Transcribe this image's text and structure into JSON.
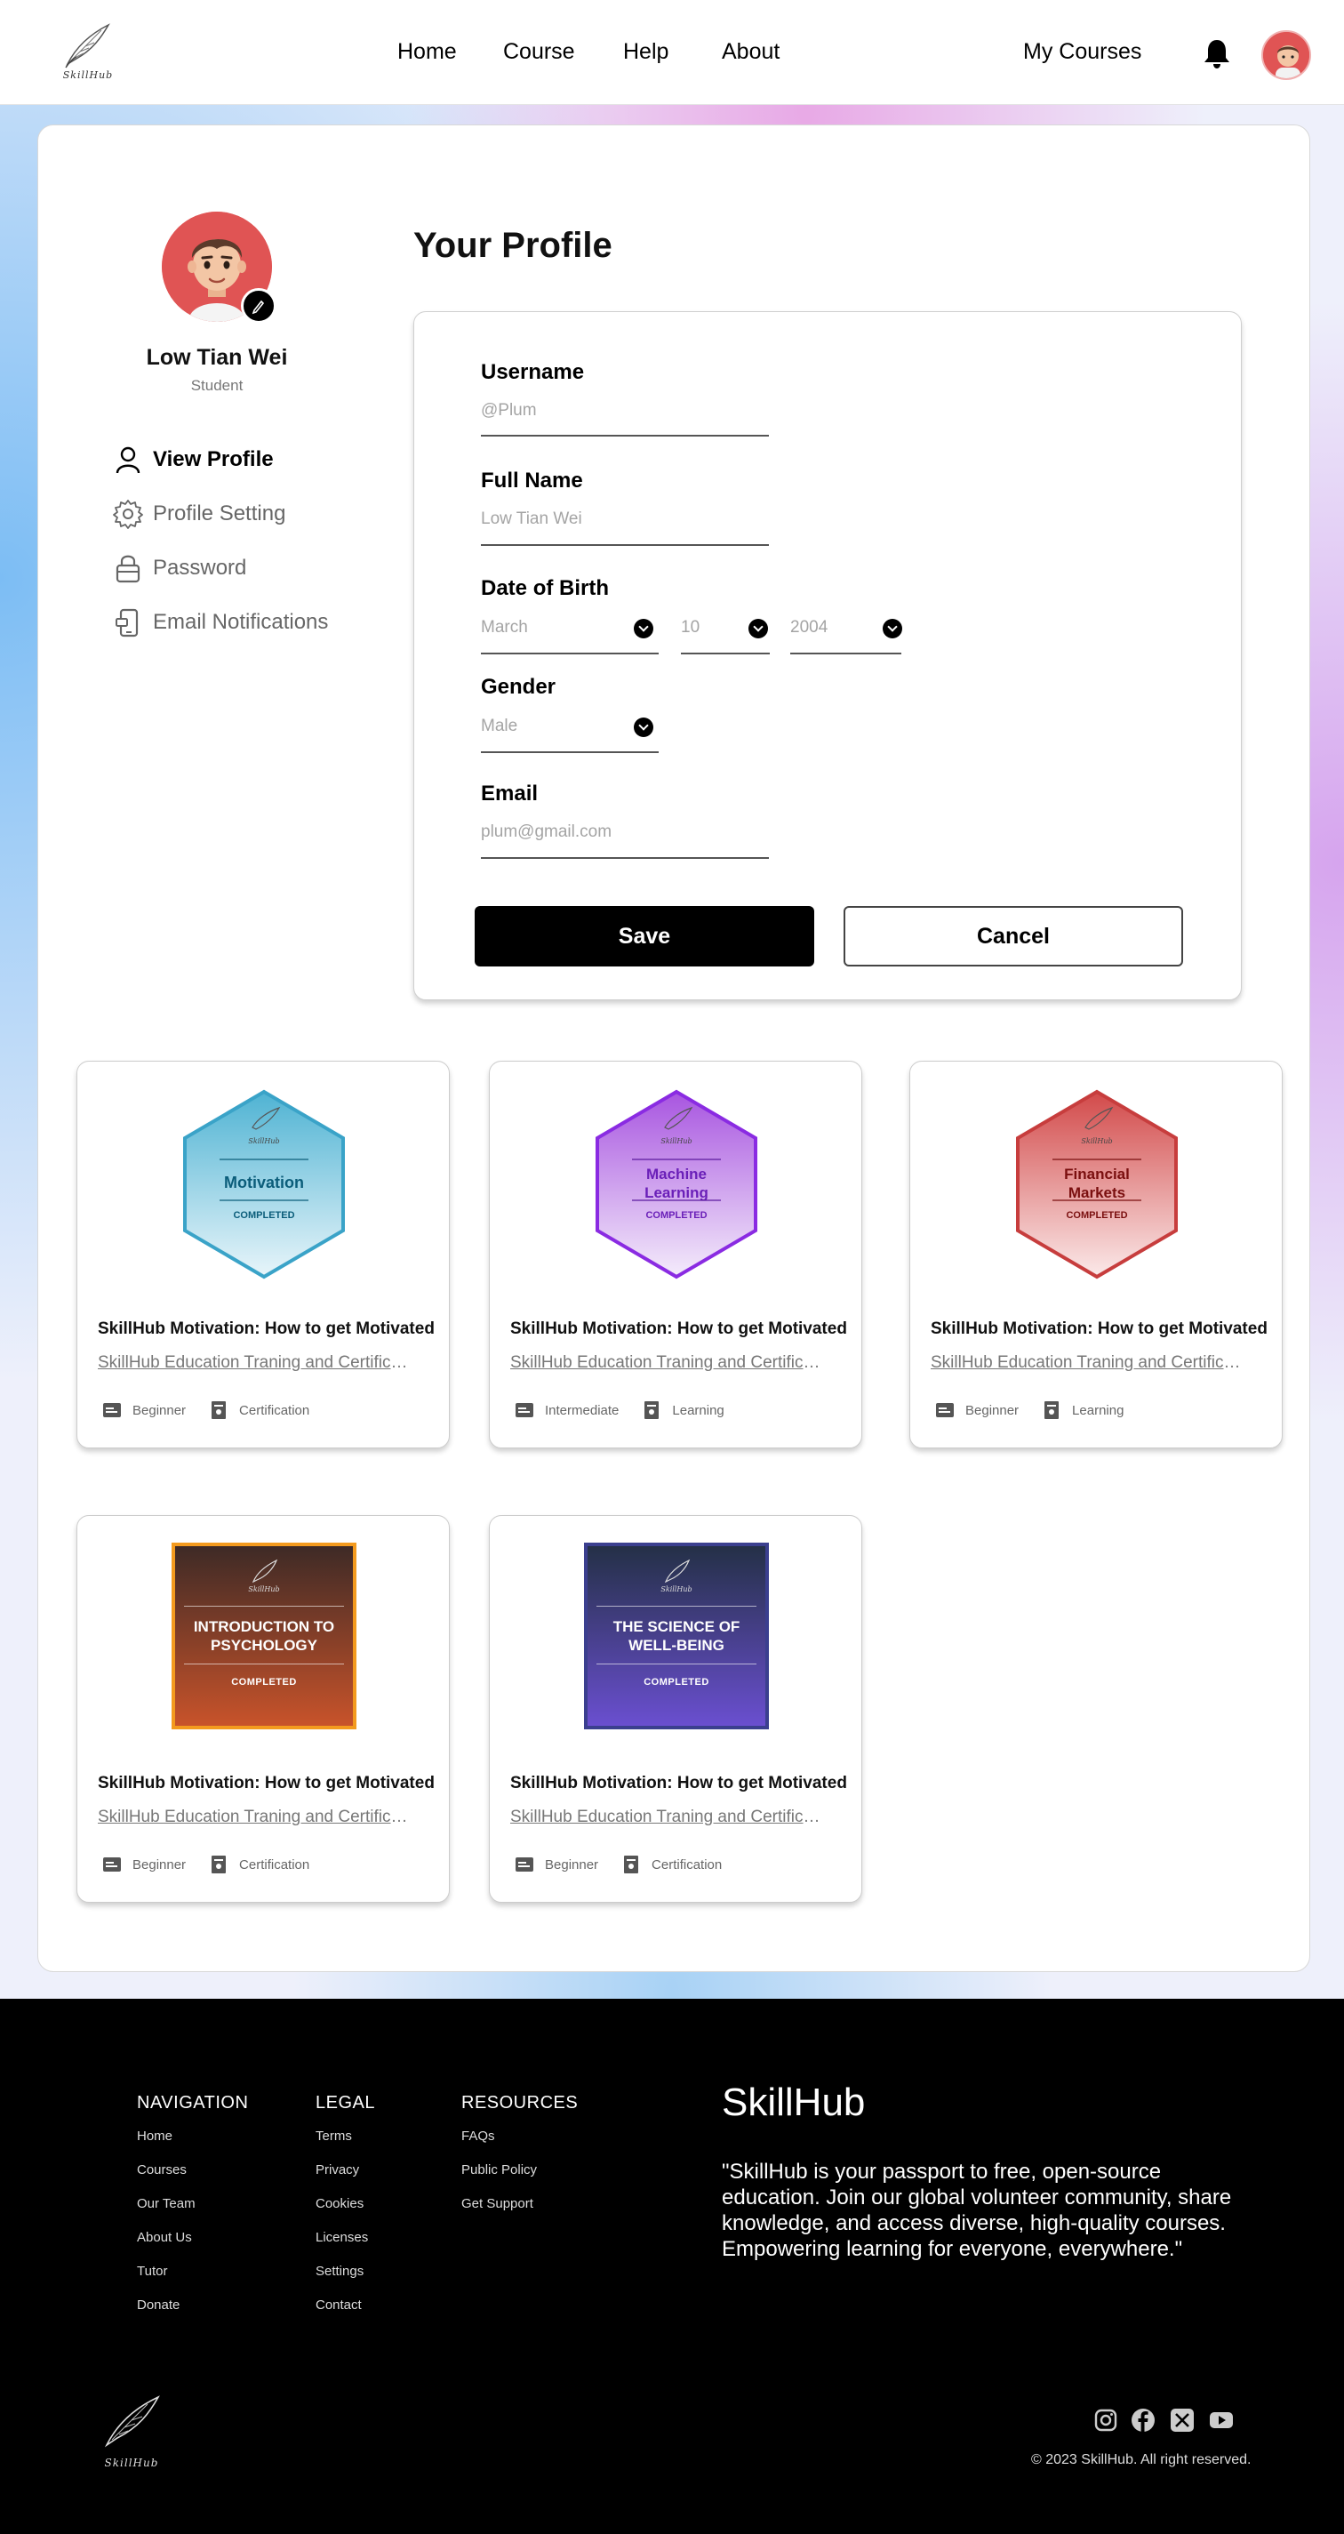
{
  "header": {
    "logo_text": "SkillHub",
    "nav": [
      "Home",
      "Course",
      "Help",
      "About"
    ],
    "my_courses": "My Courses"
  },
  "sidebar": {
    "name": "Low Tian Wei",
    "role": "Student",
    "items": [
      {
        "label": "View Profile",
        "icon": "user-icon",
        "active": true
      },
      {
        "label": "Profile Setting",
        "icon": "gear-icon",
        "active": false
      },
      {
        "label": "Password",
        "icon": "lock-icon",
        "active": false
      },
      {
        "label": "Email Notifications",
        "icon": "phone-notification-icon",
        "active": false
      }
    ]
  },
  "profile": {
    "title": "Your Profile",
    "username_label": "Username",
    "username_value": "@Plum",
    "fullname_label": "Full Name",
    "fullname_value": "Low Tian Wei",
    "dob_label": "Date of Birth",
    "dob_month": "March",
    "dob_day": "10",
    "dob_year": "2004",
    "gender_label": "Gender",
    "gender_value": "Male",
    "email_label": "Email",
    "email_value": "plum@gmail.com",
    "save": "Save",
    "cancel": "Cancel"
  },
  "courses": [
    {
      "badge_brand": "SkillHub",
      "badge_title": "Motivation",
      "badge_status": "COMPLETED",
      "badge_shape": "hexagon",
      "badge_color": "#4fb3d3",
      "title": "SkillHub Motivation: How to get Motivated",
      "provider": "SkillHub Education Traning and Certification",
      "level": "Beginner",
      "type": "Certification"
    },
    {
      "badge_brand": "SkillHub",
      "badge_title": "Machine Learning",
      "badge_status": "COMPLETED",
      "badge_shape": "hexagon",
      "badge_color": "#8a2be2",
      "title": "SkillHub Motivation: How to get Motivated",
      "provider": "SkillHub Education Traning and Certification",
      "level": "Intermediate",
      "type": "Learning"
    },
    {
      "badge_brand": "SkillHub",
      "badge_title": "Financial Markets",
      "badge_status": "COMPLETED",
      "badge_shape": "hexagon",
      "badge_color": "#d24a4a",
      "title": "SkillHub Motivation: How to get Motivated",
      "provider": "SkillHub Education Traning and Certification",
      "level": "Beginner",
      "type": "Learning"
    },
    {
      "badge_brand": "SkillHub",
      "badge_title": "INTRODUCTION TO PSYCHOLOGY",
      "badge_status": "COMPLETED",
      "badge_shape": "square",
      "badge_color": "#f39a1e",
      "title": "SkillHub Motivation: How to get Motivated",
      "provider": "SkillHub Education Traning and Certification",
      "level": "Beginner",
      "type": "Certification"
    },
    {
      "badge_brand": "SkillHub",
      "badge_title": "THE SCIENCE OF WELL-BEING",
      "badge_status": "COMPLETED",
      "badge_shape": "square",
      "badge_color": "#3b3f8f",
      "title": "SkillHub Motivation: How to get Motivated",
      "provider": "SkillHub Education Traning and Certification",
      "level": "Beginner",
      "type": "Certification"
    }
  ],
  "footer": {
    "navigation_title": "NAVIGATION",
    "navigation": [
      "Home",
      "Courses",
      "Our Team",
      "About Us",
      "Tutor",
      "Donate"
    ],
    "legal_title": "LEGAL",
    "legal": [
      "Terms",
      "Privacy",
      "Cookies",
      "Licenses",
      "Settings",
      "Contact"
    ],
    "resources_title": "RESOURCES",
    "resources": [
      "FAQs",
      "Public Policy",
      "Get Support"
    ],
    "brand": "SkillHub",
    "description": "\"SkillHub is your passport to free, open-source education. Join our global volunteer community, share knowledge, and access diverse, high-quality courses. Empowering learning for everyone, everywhere.\"",
    "logo_text": "SkillHub",
    "social": [
      "instagram-icon",
      "facebook-icon",
      "x-icon",
      "youtube-icon"
    ],
    "copyright": "© 2023 SkillHub. All right reserved."
  }
}
